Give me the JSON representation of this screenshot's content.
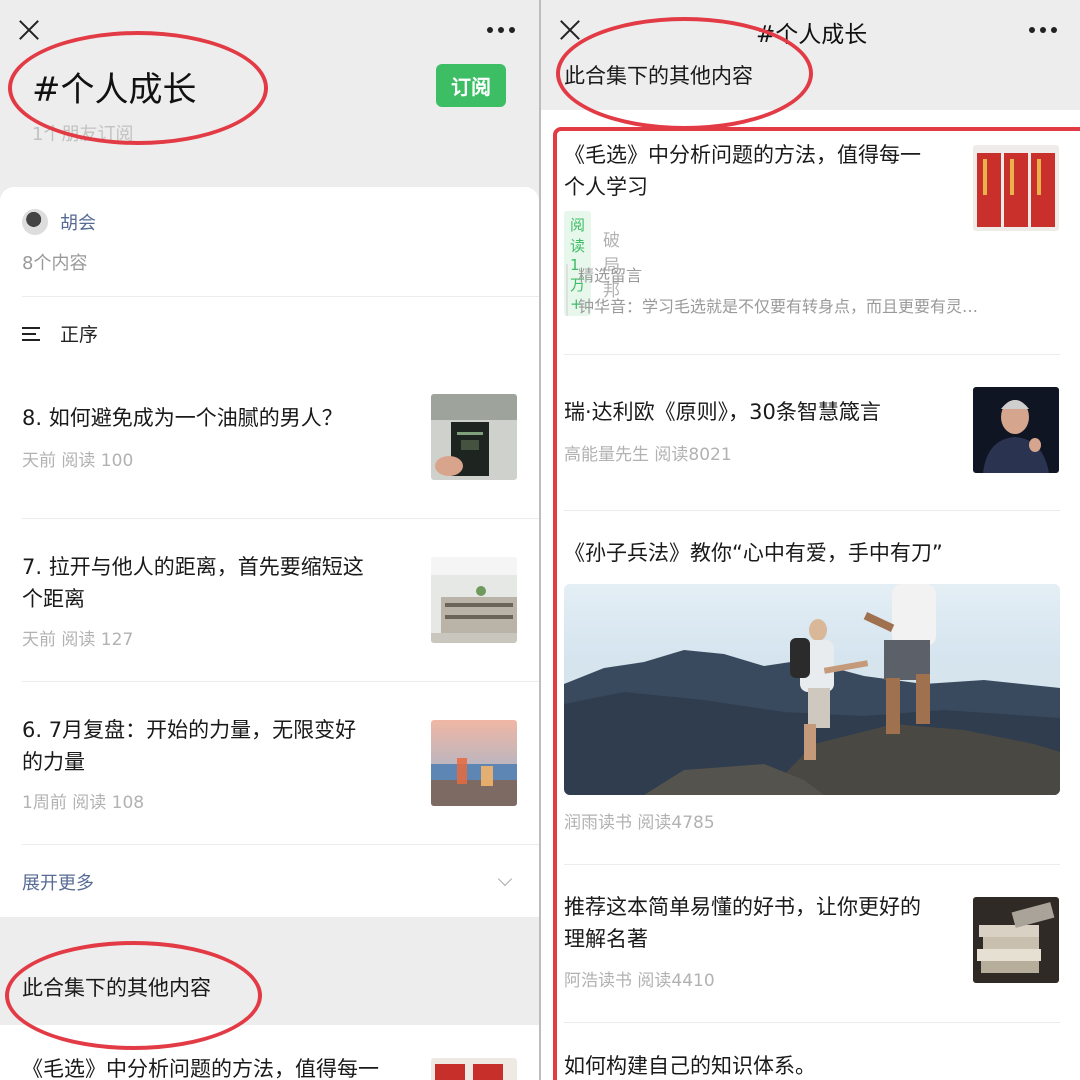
{
  "left": {
    "title": "#个人成长",
    "subscribe_label": "订阅",
    "friends_text": "1个朋友订阅",
    "author": {
      "name": "胡会",
      "count_text": "8个内容"
    },
    "sort_label": "正序",
    "articles": [
      {
        "title_lines": [
          "8. 如何避免成为一个油腻的男人？"
        ],
        "meta": "天前  阅读 100"
      },
      {
        "title_lines": [
          "7. 拉开与他人的距离，首先要缩短这",
          "个距离"
        ],
        "meta": "天前  阅读 127"
      },
      {
        "title_lines": [
          "6. 7月复盘：开始的力量，无限变好",
          "的力量"
        ],
        "meta": "1周前  阅读 108"
      }
    ],
    "expand_label": "展开更多",
    "other_header": "此合集下的其他内容",
    "bottom_article_title": "《毛选》中分析问题的方法，值得每一"
  },
  "right": {
    "title": "#个人成长",
    "other_header": "此合集下的其他内容",
    "articles": [
      {
        "title_lines": [
          "《毛选》中分析问题的方法，值得每一",
          "个人学习"
        ],
        "badge": "阅读1万+",
        "source": "破局邦",
        "comment_label": "精选留言",
        "comment_text": "钟华音：学习毛选就是不仅要有转身点，而且更要有灵…"
      },
      {
        "title_lines": [
          "瑞·达利欧《原则》，30条智慧箴言"
        ],
        "meta": "高能量先生  阅读8021"
      },
      {
        "title_lines": [
          "《孙子兵法》教你“心中有爱，手中有刀”"
        ],
        "meta": "润雨读书  阅读4785"
      },
      {
        "title_lines": [
          "推荐这本简单易懂的好书，让你更好的",
          "理解名著"
        ],
        "meta": "阿浩读书  阅读4410"
      },
      {
        "title_lines": [
          "如何构建自己的知识体系。"
        ]
      }
    ]
  },
  "colors": {
    "accent_green": "#3dbd64",
    "link_blue": "#576b95",
    "annotation_red": "#e23b45"
  }
}
